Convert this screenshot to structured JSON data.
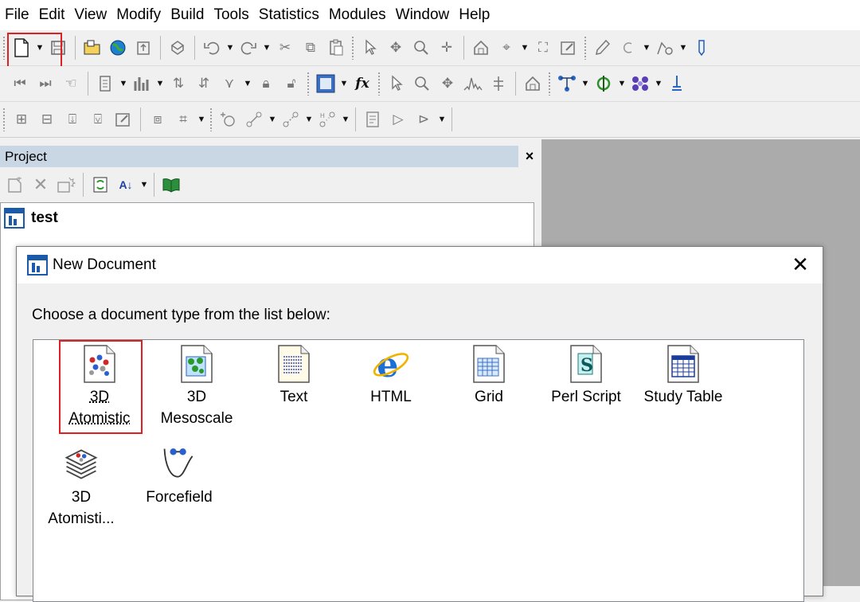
{
  "menubar": {
    "items": [
      "File",
      "Edit",
      "View",
      "Modify",
      "Build",
      "Tools",
      "Statistics",
      "Modules",
      "Window",
      "Help"
    ]
  },
  "project": {
    "title": "Project",
    "close_glyph": "×",
    "tree_root": "test"
  },
  "dialog": {
    "title": "New Document",
    "close_glyph": "✕",
    "instruction": "Choose a document type from the list below:",
    "doc_types": [
      {
        "line1": "3D",
        "line2": "Atomistic",
        "icon": "3d-atomistic-icon"
      },
      {
        "line1": "3D",
        "line2": "Mesoscale",
        "icon": "3d-mesoscale-icon"
      },
      {
        "line1": "Text",
        "line2": "",
        "icon": "text-document-icon"
      },
      {
        "line1": "HTML",
        "line2": "",
        "icon": "html-ie-icon"
      },
      {
        "line1": "Grid",
        "line2": "",
        "icon": "grid-document-icon"
      },
      {
        "line1": "Perl Script",
        "line2": "",
        "icon": "perl-script-icon"
      },
      {
        "line1": "Study Table",
        "line2": "",
        "icon": "study-table-icon"
      },
      {
        "line1": "3D",
        "line2": "Atomisti...",
        "icon": "3d-atomistic-collection-icon"
      },
      {
        "line1": "Forcefield",
        "line2": "",
        "icon": "forcefield-icon"
      }
    ]
  },
  "colors": {
    "highlight_red": "#e02020",
    "panel_header": "#c9d6e4",
    "workspace_gray": "#ababab"
  }
}
